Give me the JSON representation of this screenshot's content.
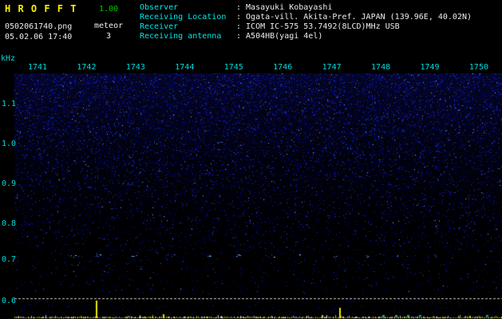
{
  "header": {
    "title": "H R O F F T",
    "version": "1.00",
    "filename": "0502061740.png",
    "mode_label": "meteor",
    "timestamp": "05.02.06 17:40",
    "meteor_count": "3",
    "separator": ":",
    "info_rows": [
      {
        "label": "Observer",
        "value": "Masayuki Kobayashi"
      },
      {
        "label": "Receiving Location",
        "value": "Ogata-vill. Akita-Pref. JAPAN (139.96E, 40.02N)"
      },
      {
        "label": "Receiver",
        "value": "ICOM IC-575 53.7492(8LCD)MHz USB"
      },
      {
        "label": "Receiving antenna",
        "value": "A504HB(yagi 4el)"
      }
    ]
  },
  "chart_data": {
    "type": "heatmap",
    "title": "HROFFT radio meteor echo spectrogram (10-minute window)",
    "x_ticks": [
      "1741",
      "1742",
      "1743",
      "1744",
      "1745",
      "1746",
      "1747",
      "1748",
      "1749",
      "1750"
    ],
    "xlabel": "",
    "ylabel": "kHz",
    "y_ticks": [
      "1.1",
      "1.0",
      "0.9",
      "0.8",
      "0.7",
      "0.6"
    ],
    "ylim": [
      0.6,
      1.15
    ],
    "grid": false,
    "legend": false,
    "echo_trace_khz": 0.72,
    "echo_positions_frac": [
      0.126,
      0.17,
      0.245,
      0.322,
      0.4,
      0.458,
      0.527,
      0.589,
      0.658,
      0.727,
      0.789,
      0.859
    ],
    "level_spikes": [
      {
        "x_frac": 0.167,
        "h": 22
      },
      {
        "x_frac": 0.305,
        "h": 5
      },
      {
        "x_frac": 0.666,
        "h": 13
      }
    ],
    "cyan_marks_frac": [
      0.755,
      0.78,
      0.805,
      0.83,
      0.968
    ],
    "colors": {
      "noise": [
        "#000070",
        "#0011a0",
        "#1c2fd0",
        "#3350e8",
        "#7fb0ff"
      ],
      "trace": [
        "#3366ee",
        "#55a0ff",
        "#88d0ff"
      ],
      "baseline_yellow": "#b8b800",
      "baseline_white": "#c8c8c8",
      "spike": "#e8e800",
      "cyan_marks": "#00b8b8",
      "dashed_line": "#c8c8c8"
    }
  },
  "colors": {
    "background": "#000000",
    "title": "#f8f000",
    "version": "#00c800",
    "cyan": "#00e8e8",
    "value": "#ededed",
    "axis": "#00dcdc"
  }
}
